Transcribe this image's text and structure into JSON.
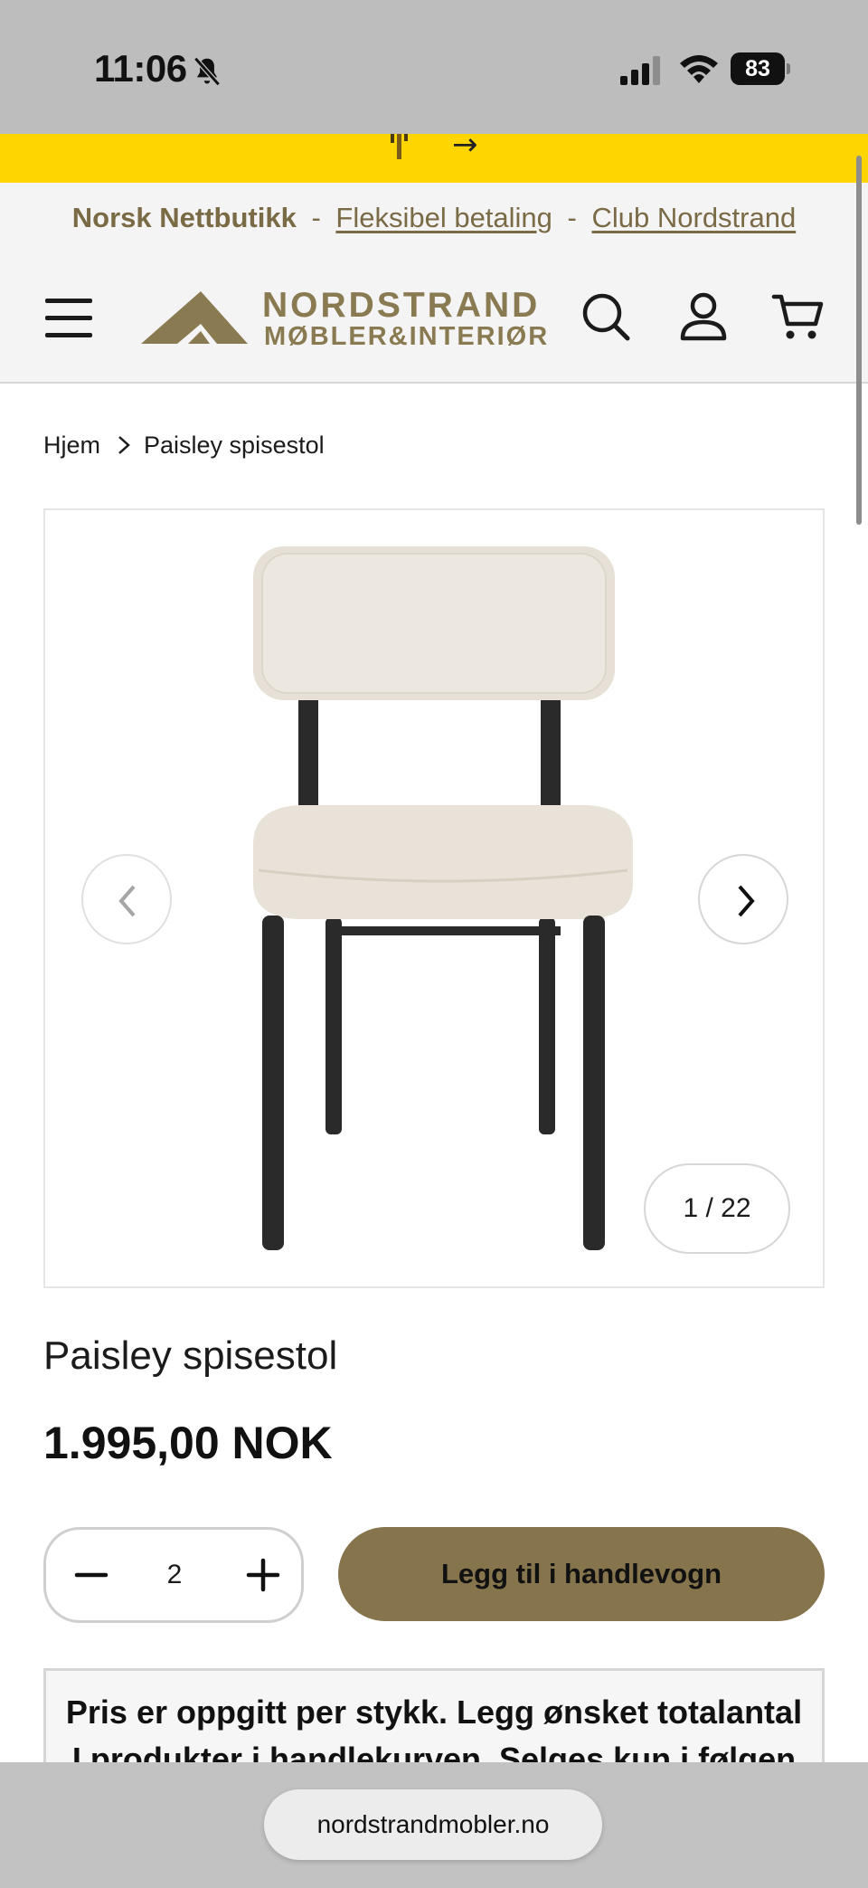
{
  "status_bar": {
    "time": "11:06",
    "battery": "83",
    "icons": [
      "bell-off-icon",
      "signal-icon",
      "wifi-icon",
      "battery-icon"
    ]
  },
  "promo": {
    "arrow": "→"
  },
  "announcement": {
    "brand": "Norsk Nettbutikk",
    "separator_1": "-",
    "link_1": "Fleksibel betaling",
    "separator_2": "-",
    "link_2": "Club Nordstrand"
  },
  "header": {
    "logo_name": "NORDSTRAND",
    "logo_sub": "MØBLER&INTERIØR",
    "icons": [
      "menu-icon",
      "search-icon",
      "account-icon",
      "cart-icon"
    ]
  },
  "breadcrumb": {
    "home": "Hjem",
    "current": "Paisley spisestol"
  },
  "gallery": {
    "counter": "1 / 22"
  },
  "product": {
    "title": "Paisley spisestol",
    "price": "1.995,00 NOK",
    "quantity": "2",
    "add_to_cart_label": "Legg til i handlevogn",
    "note": "Pris er oppgitt per stykk. Legg ønsket totalantal I produkter i handlekurven. Selges kun i følgen"
  },
  "browser": {
    "url": "nordstrandmobler.no"
  },
  "colors": {
    "accent_gold": "#85744c",
    "logo_gold": "#8a7a52",
    "promo_yellow": "#ffd500"
  }
}
